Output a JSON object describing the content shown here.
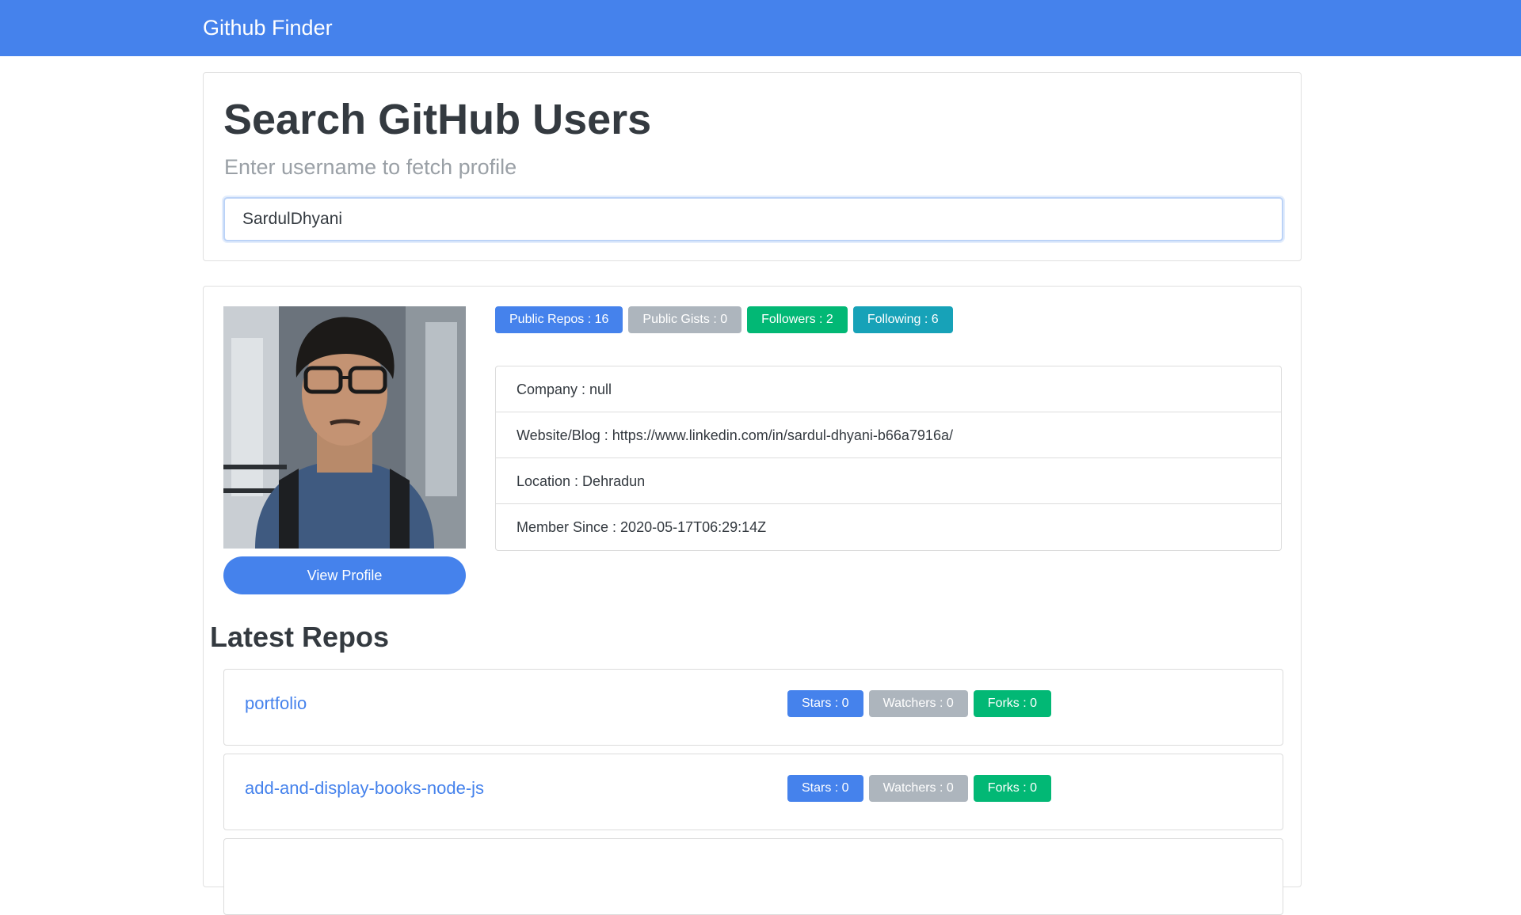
{
  "navbar": {
    "brand": "Github Finder"
  },
  "search": {
    "title": "Search GitHub Users",
    "subtitle": "Enter username to fetch profile",
    "value": "SardulDhyani"
  },
  "profile": {
    "view_profile_label": "View Profile",
    "badges": {
      "public_repos": "Public Repos : 16",
      "public_gists": "Public Gists : 0",
      "followers": "Followers : 2",
      "following": "Following : 6"
    },
    "info": {
      "company": "Company : null",
      "website": "Website/Blog : https://www.linkedin.com/in/sardul-dhyani-b66a7916a/",
      "location": "Location : Dehradun",
      "member_since": "Member Since : 2020-05-17T06:29:14Z"
    }
  },
  "repos": {
    "heading": "Latest Repos",
    "items": [
      {
        "name": "portfolio",
        "stars": "Stars : 0",
        "watchers": "Watchers : 0",
        "forks": "Forks : 0"
      },
      {
        "name": "add-and-display-books-node-js",
        "stars": "Stars : 0",
        "watchers": "Watchers : 0",
        "forks": "Forks : 0"
      }
    ]
  },
  "colors": {
    "primary": "#4582ec",
    "secondary": "#adb5bd",
    "success": "#02b875",
    "info": "#17a2b8"
  }
}
